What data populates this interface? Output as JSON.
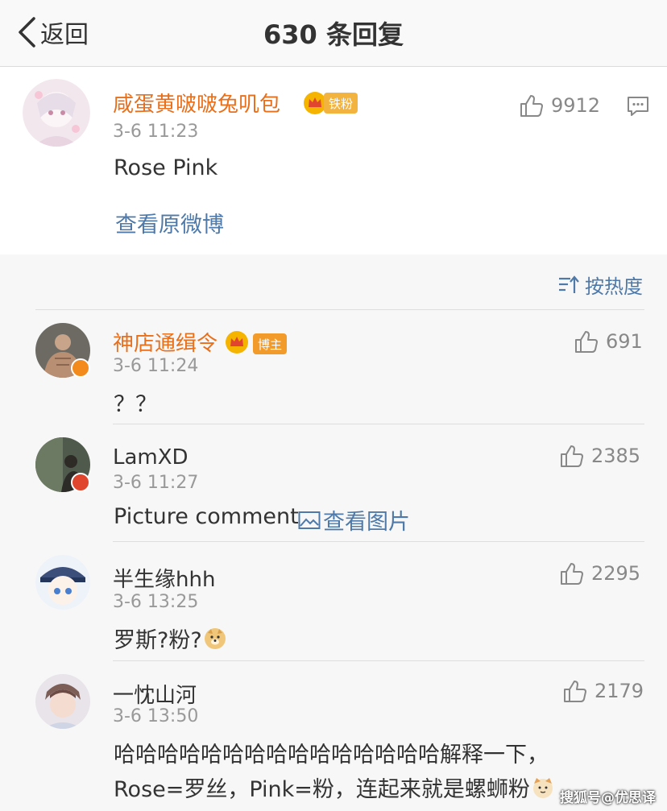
{
  "header": {
    "back_label": "返回",
    "title": "630 条回复"
  },
  "post": {
    "username": "咸蛋黄啵啵兔叽包",
    "badge": "铁粉",
    "time": "3-6 11:23",
    "text": "Rose Pink",
    "likes": "9912",
    "view_original": "查看原微博"
  },
  "sort_label": "按热度",
  "replies": [
    {
      "username": "神店通缉令",
      "badge": "博主",
      "time": "3-6 11:24",
      "text": "？？",
      "likes": "691"
    },
    {
      "username": "LamXD",
      "time": "3-6 11:27",
      "text": "Picture comment",
      "pic_link": "查看图片",
      "likes": "2385"
    },
    {
      "username": "半生缘hhh",
      "time": "3-6 13:25",
      "text": "罗斯?粉?",
      "likes": "2295"
    },
    {
      "username": "一忱山河",
      "time": "3-6 13:50",
      "text_line1": "哈哈哈哈哈哈哈哈哈哈哈哈哈哈哈解释一下，",
      "text_line2": "Rose=罗丝，Pink=粉，连起来就是螺蛳粉",
      "likes": "2179"
    }
  ],
  "watermark": "搜狐号@优思译",
  "colors": {
    "username_orange": "#e86f1c",
    "link_blue": "#4e79a8",
    "badge_gold": "#f3b33f",
    "vip_red": "#e0452d"
  }
}
